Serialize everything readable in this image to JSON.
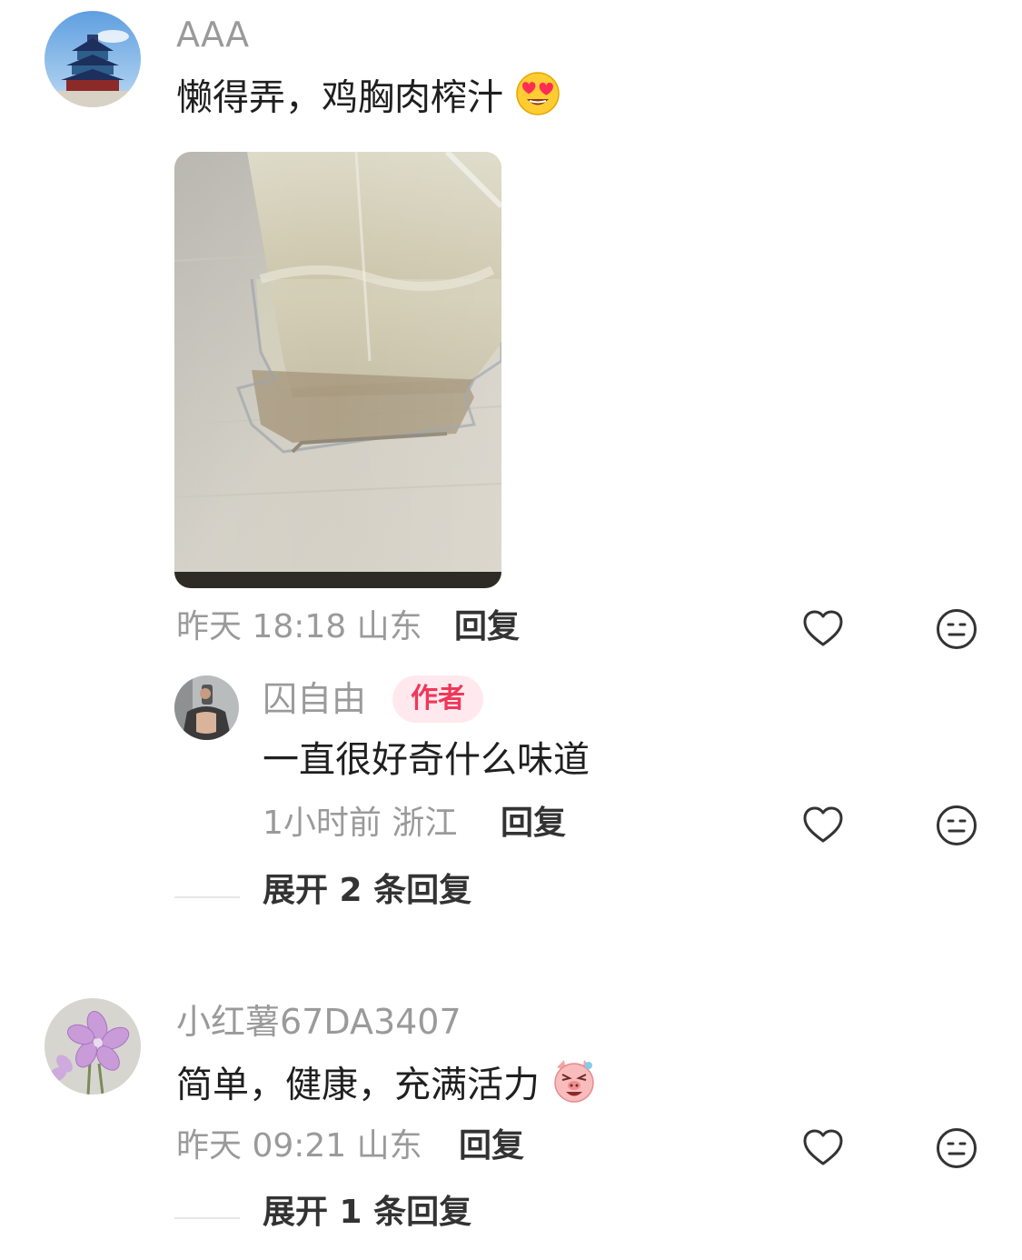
{
  "comments": [
    {
      "username": "AAA",
      "text": "懒得弄，鸡胸肉榨汁",
      "emoji": "heart-eyes-emoji",
      "time": "昨天 18:18",
      "location": "山东",
      "reply_label": "回复",
      "replies": [
        {
          "username": "囚自由",
          "badge": "作者",
          "text": "一直很好奇什么味道",
          "time": "1小时前",
          "location": "浙江",
          "reply_label": "回复"
        }
      ],
      "expand_label": "展开 2 条回复"
    },
    {
      "username": "小红薯67DA3407",
      "text": "简单，健康，充满活力",
      "emoji": "pig-laughing-emoji",
      "time": "昨天 09:21",
      "location": "山东",
      "reply_label": "回复",
      "expand_label": "展开 1 条回复"
    }
  ],
  "icons": {
    "like": "heart-outline-icon",
    "dislike": "meh-face-icon"
  },
  "colors": {
    "badge_bg": "#ffe9ee",
    "badge_text": "#f0375a",
    "meta": "#9a9a9a"
  }
}
